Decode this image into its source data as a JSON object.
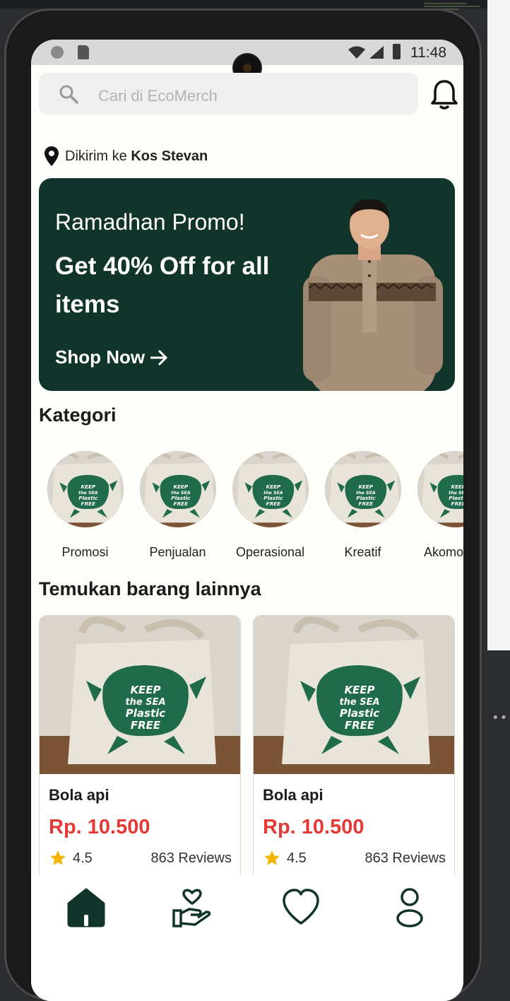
{
  "status_bar": {
    "time": "11:48"
  },
  "search": {
    "placeholder": "Cari di EcoMerch"
  },
  "delivery": {
    "prefix": "Dikirim ke",
    "location": "Kos Stevan"
  },
  "banner": {
    "subtitle": "Ramadhan Promo!",
    "title": "Get 40% Off for all items",
    "cta": "Shop Now"
  },
  "categories": {
    "title": "Kategori",
    "items": [
      {
        "label": "Promosi"
      },
      {
        "label": "Penjualan"
      },
      {
        "label": "Operasional"
      },
      {
        "label": "Kreatif"
      },
      {
        "label": "Akomodasi"
      }
    ]
  },
  "products": {
    "title": "Temukan barang lainnya",
    "items": [
      {
        "name": "Bola api",
        "price": "Rp. 10.500",
        "rating": "4.5",
        "reviews": "863 Reviews"
      },
      {
        "name": "Bola api",
        "price": "Rp. 10.500",
        "rating": "4.5",
        "reviews": "863 Reviews"
      }
    ]
  },
  "bottom_nav": {
    "items": [
      {
        "icon": "home-icon",
        "active": true
      },
      {
        "icon": "donate-icon",
        "active": false
      },
      {
        "icon": "heart-icon",
        "active": false
      },
      {
        "icon": "profile-icon",
        "active": false
      }
    ]
  },
  "colors": {
    "primary": "#11352a",
    "price": "#e53935",
    "star": "#f5b400"
  }
}
